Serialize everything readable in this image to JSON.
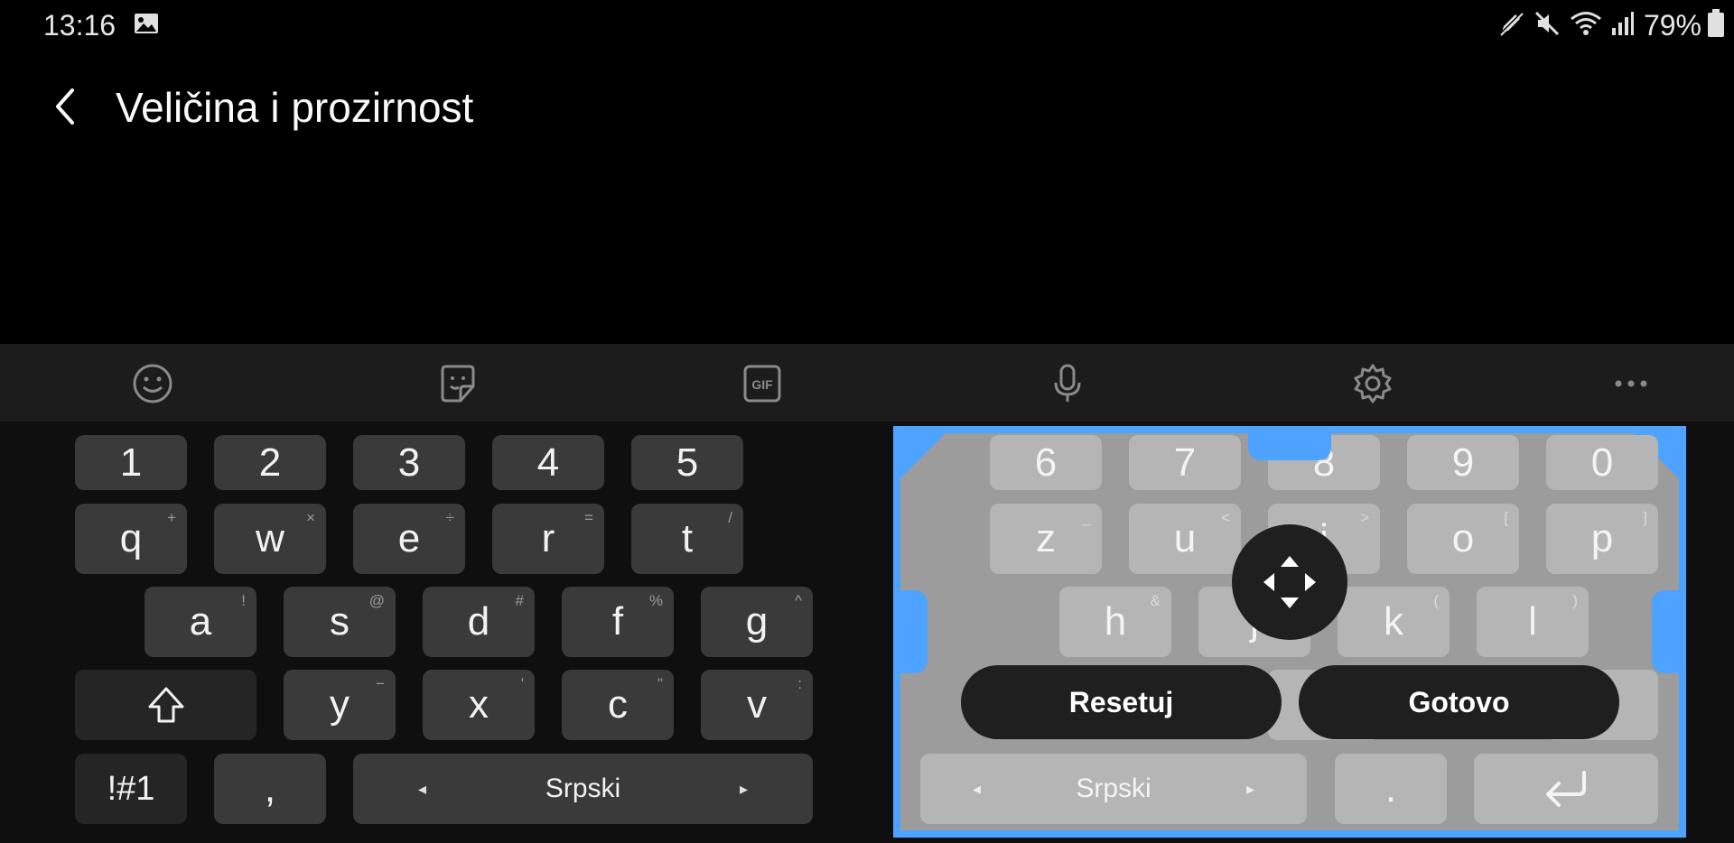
{
  "status_bar": {
    "time": "13:16",
    "battery_percent": "79%",
    "icons": [
      "image-icon",
      "pen-icon",
      "mute-icon",
      "wifi-icon",
      "signal-icon",
      "battery-icon"
    ]
  },
  "header": {
    "title": "Veličina i prozirnost",
    "back_icon": "chevron-left-icon"
  },
  "toolbar": {
    "items": [
      "emoji-icon",
      "sticker-icon",
      "gif-icon",
      "mic-icon",
      "settings-icon",
      "more-icon"
    ],
    "gif_label": "GIF"
  },
  "keyboard_left": {
    "numbers": [
      "1",
      "2",
      "3",
      "4",
      "5"
    ],
    "row1": [
      {
        "key": "q",
        "sub": "+"
      },
      {
        "key": "w",
        "sub": "×"
      },
      {
        "key": "e",
        "sub": "÷"
      },
      {
        "key": "r",
        "sub": "="
      },
      {
        "key": "t",
        "sub": "/"
      }
    ],
    "row2": [
      {
        "key": "a",
        "sub": "!"
      },
      {
        "key": "s",
        "sub": "@"
      },
      {
        "key": "d",
        "sub": "#"
      },
      {
        "key": "f",
        "sub": "%"
      },
      {
        "key": "g",
        "sub": "^"
      }
    ],
    "row3": [
      {
        "key": "y",
        "sub": "−"
      },
      {
        "key": "x",
        "sub": "'"
      },
      {
        "key": "c",
        "sub": "\""
      },
      {
        "key": "v",
        "sub": ":"
      }
    ],
    "symbols_key": "!#1",
    "comma_key": ",",
    "space_label": "Srpski",
    "space_left_arrow": "◂",
    "space_right_arrow": "▸"
  },
  "keyboard_right": {
    "numbers": [
      "6",
      "7",
      "8",
      "9",
      "0"
    ],
    "row1": [
      {
        "key": "z",
        "sub": "_"
      },
      {
        "key": "u",
        "sub": "<"
      },
      {
        "key": "i",
        "sub": ">"
      },
      {
        "key": "o",
        "sub": "["
      },
      {
        "key": "p",
        "sub": "]"
      }
    ],
    "row2": [
      {
        "key": "h",
        "sub": "&"
      },
      {
        "key": "j",
        "sub": "*"
      },
      {
        "key": "k",
        "sub": "("
      },
      {
        "key": "l",
        "sub": ")"
      }
    ],
    "space_label": "Srpski",
    "space_left_arrow": "◂",
    "space_right_arrow": "▸",
    "period_key": ".",
    "reset_label": "Resetuj",
    "done_label": "Gotovo"
  },
  "colors": {
    "accent": "#4da3ff",
    "key_bg": "#3a3a3a",
    "panel_bg": "#9c9c9c"
  }
}
